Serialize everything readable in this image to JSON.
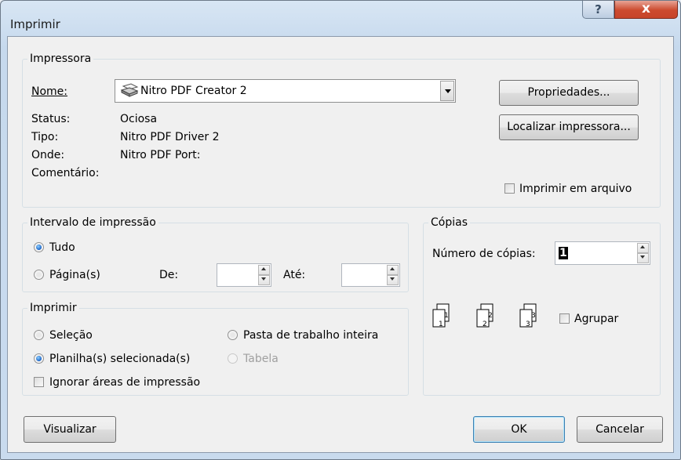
{
  "window": {
    "title": "Imprimir",
    "help_glyph": "?",
    "close_glyph": "x"
  },
  "printer": {
    "group_title": "Impressora",
    "name_label": "Nome:",
    "name_value": "Nitro PDF Creator 2",
    "status_label": "Status:",
    "status_value": "Ociosa",
    "type_label": "Tipo:",
    "type_value": "Nitro PDF Driver 2",
    "where_label": "Onde:",
    "where_value": "Nitro PDF Port:",
    "comment_label": "Comentário:",
    "properties_button": "Propriedades...",
    "find_printer_button": "Localizar impressora...",
    "print_to_file_label": "Imprimir em arquivo",
    "print_to_file_checked": false
  },
  "range": {
    "group_title": "Intervalo de impressão",
    "all_label": "Tudo",
    "all_selected": true,
    "pages_label": "Página(s)",
    "from_label": "De:",
    "from_value": "",
    "to_label": "Até:",
    "to_value": ""
  },
  "print_what": {
    "group_title": "Imprimir",
    "selection_label": "Seleção",
    "active_sheets_label": "Planilha(s) selecionada(s)",
    "active_sheets_selected": true,
    "entire_workbook_label": "Pasta de trabalho inteira",
    "table_label": "Tabela",
    "table_disabled": true,
    "ignore_areas_label": "Ignorar áreas de impressão",
    "ignore_areas_checked": false
  },
  "copies": {
    "group_title": "Cópias",
    "number_label": "Número de cópias:",
    "number_value": "1",
    "collate_label": "Agrupar",
    "collate_checked": false,
    "collate_icons": [
      {
        "front": "1",
        "back": "1"
      },
      {
        "front": "2",
        "back": "2"
      },
      {
        "front": "3",
        "back": "3"
      }
    ]
  },
  "footer": {
    "preview_button": "Visualizar",
    "ok_button": "OK",
    "cancel_button": "Cancelar"
  }
}
